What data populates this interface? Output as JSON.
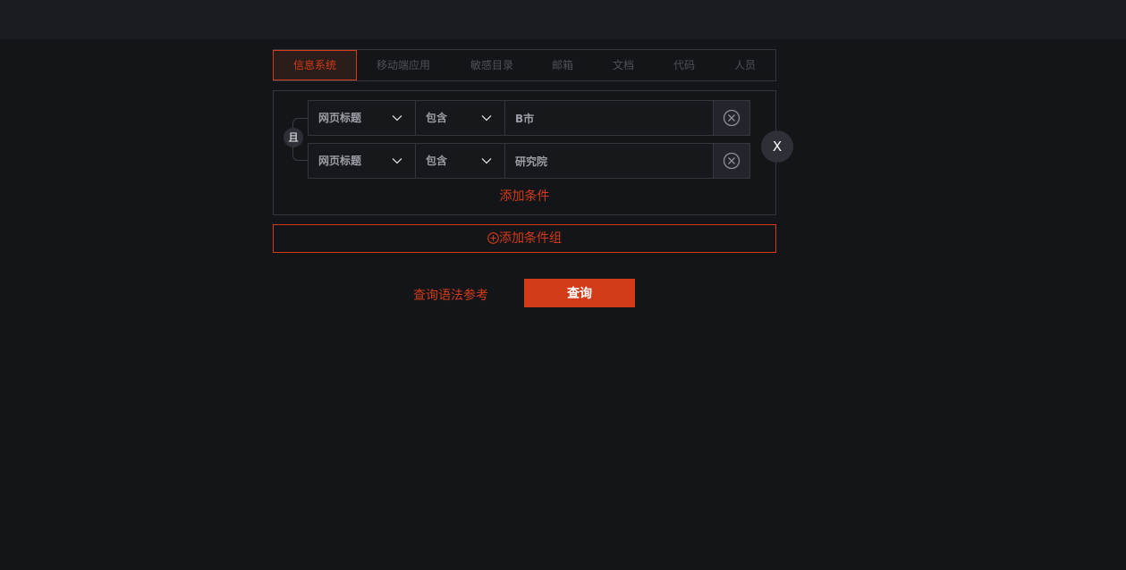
{
  "tabs": [
    {
      "label": "信息系统",
      "active": true
    },
    {
      "label": "移动端应用"
    },
    {
      "label": "敏感目录"
    },
    {
      "label": "邮箱"
    },
    {
      "label": "文档"
    },
    {
      "label": "代码"
    },
    {
      "label": "人员"
    }
  ],
  "group": {
    "logic_label": "且",
    "conditions": [
      {
        "field": "网页标题",
        "operator": "包含",
        "value": "B市"
      },
      {
        "field": "网页标题",
        "operator": "包含",
        "value": "研究院"
      }
    ],
    "add_condition_label": "添加条件",
    "close_label": "X"
  },
  "add_group_label": "添加条件组",
  "syntax_link_label": "查询语法参考",
  "query_button_label": "查询",
  "icons": {
    "chevron": "chevron-down-icon",
    "delete": "close-circle-icon",
    "add": "plus-circle-icon"
  },
  "colors": {
    "accent": "#d23a18",
    "background": "#141519",
    "border": "#34363d"
  }
}
